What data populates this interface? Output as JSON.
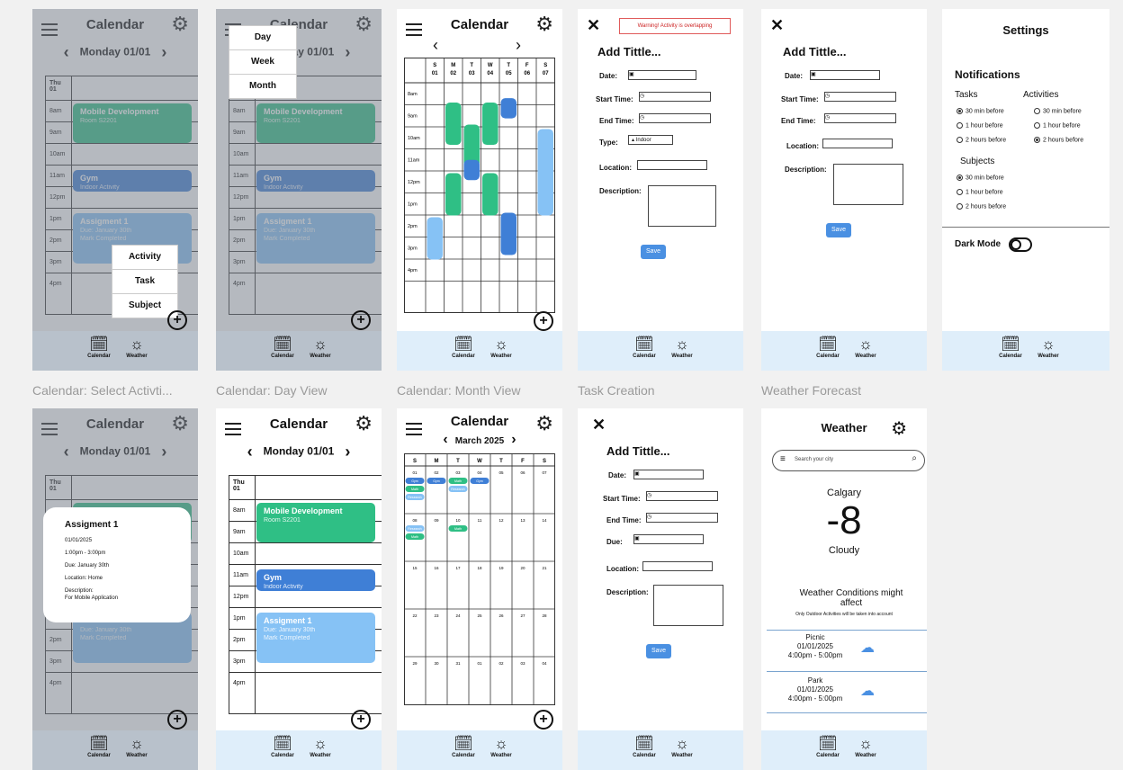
{
  "captions": [
    "Calendar: Select Activti...",
    "Calendar: Day View",
    "Calendar: Month View",
    "Task Creation",
    "Weather Forecast"
  ],
  "app": {
    "title": "Calendar",
    "date": "Monday 01/01",
    "day_head_top": "Thu",
    "day_head_num": "01"
  },
  "times": [
    "8am",
    "9am",
    "10am",
    "11am",
    "12pm",
    "1pm",
    "2pm",
    "3pm",
    "4pm"
  ],
  "events": {
    "mobile": {
      "title": "Mobile Development",
      "sub": "Room S2201"
    },
    "gym": {
      "title": "Gym",
      "sub": "Indoor Activity"
    },
    "assign": {
      "title": "Assigment 1",
      "sub": "Due: January 30th",
      "check": "Mark Completed"
    }
  },
  "nav": {
    "calendar": "Calendar",
    "weather": "Weather"
  },
  "add_menu": [
    "Activity",
    "Task",
    "Subject"
  ],
  "view_menu": [
    "Day",
    "Week",
    "Month"
  ],
  "week": {
    "letters": [
      "S",
      "M",
      "T",
      "W",
      "T",
      "F",
      "S"
    ],
    "days": [
      "01",
      "02",
      "03",
      "04",
      "05",
      "06",
      "07"
    ],
    "times": [
      "8am",
      "9am",
      "10am",
      "11am",
      "12pm",
      "1pm",
      "2pm",
      "3pm",
      "4pm"
    ]
  },
  "form": {
    "warning": "Warning! Activity is overlapping",
    "title": "Add Tittle...",
    "date": "Date:",
    "start": "Start Time:",
    "end": "End Time:",
    "type": "Type:",
    "type_val": "Indoor",
    "location": "Location:",
    "description": "Description:",
    "due": "Due:",
    "save": "Save"
  },
  "settings": {
    "title": "Settings",
    "notifications": "Notifications",
    "tasks": "Tasks",
    "activities": "Activities",
    "subjects": "Subjects",
    "opts": [
      "30 min before",
      "1 hour before",
      "2 hours before"
    ],
    "dark": "Dark Mode"
  },
  "detail": {
    "title": "Assigment 1",
    "date": "01/01/2025",
    "time": "1:00pm - 3:00pm",
    "due": "Due: January 30th",
    "loc": "Location: Home",
    "desc_label": "Description:",
    "desc": "For Mobile Application"
  },
  "month": {
    "title": "March 2025",
    "letters": [
      "S",
      "M",
      "T",
      "W",
      "T",
      "F",
      "S"
    ],
    "weeks": [
      [
        "01",
        "02",
        "03",
        "04",
        "05",
        "06",
        "07"
      ],
      [
        "08",
        "09",
        "10",
        "11",
        "12",
        "13",
        "14"
      ],
      [
        "15",
        "16",
        "17",
        "18",
        "19",
        "20",
        "21"
      ],
      [
        "22",
        "23",
        "24",
        "25",
        "26",
        "27",
        "28"
      ],
      [
        "29",
        "30",
        "31",
        "01",
        "02",
        "03",
        "04"
      ]
    ],
    "chips": [
      "Gym",
      "Gym",
      "Math",
      "Gym",
      "Math",
      "Research",
      "Research",
      "Math",
      "Research",
      "Math"
    ]
  },
  "weather": {
    "title": "Weather",
    "search_placeholder": "Search your city",
    "city": "Calgary",
    "temp": "-8",
    "cond": "Cloudy",
    "warn": "Weather Conditions might affect",
    "note": "Only Outdoor Activities will be taken into account",
    "items": [
      {
        "name": "Picnic",
        "date": "01/01/2025",
        "time": "4:00pm - 5:00pm"
      },
      {
        "name": "Park",
        "date": "01/01/2025",
        "time": "4:00pm - 5:00pm"
      }
    ]
  },
  "colors": {
    "green": "#2fbf85",
    "blue": "#3f7fd6",
    "lightblue": "#86c2f5",
    "nav": "#dfeefa"
  }
}
